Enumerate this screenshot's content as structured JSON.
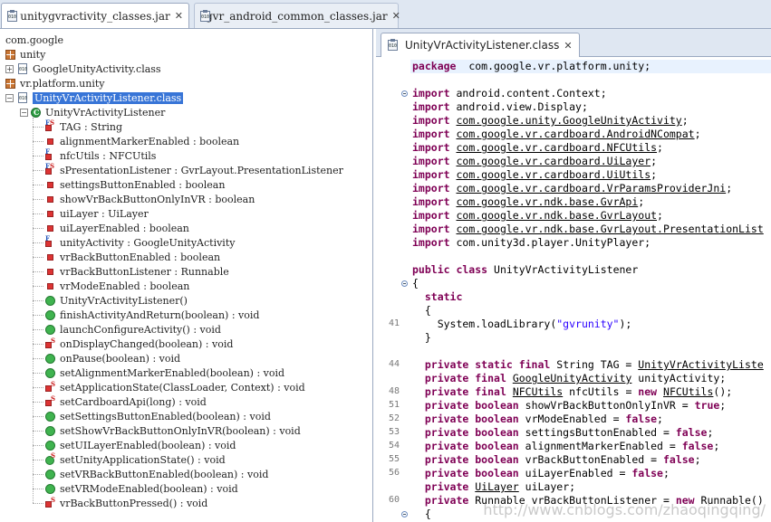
{
  "tabs": [
    {
      "label": "unitygvractivity_classes.jar",
      "active": true
    },
    {
      "label": "gvr_android_common_classes.jar",
      "active": false
    }
  ],
  "jar_icon_text": "010",
  "close_glyph": "✕",
  "tree": [
    {
      "text": "com.google",
      "indent": 0,
      "icon": "none"
    },
    {
      "text": "unity",
      "indent": 0,
      "icon": "package"
    },
    {
      "text": "GoogleUnityActivity.class",
      "indent": 1,
      "icon": "classfile",
      "expand": "+"
    },
    {
      "text": "vr.platform.unity",
      "indent": 0,
      "icon": "package"
    },
    {
      "text": "UnityVrActivityListener.class",
      "indent": 1,
      "icon": "classfile",
      "expand": "-",
      "selected": true
    },
    {
      "text": "UnityVrActivityListener",
      "indent": 2,
      "icon": "class",
      "expand": "-"
    },
    {
      "text": "TAG : String",
      "indent": 3,
      "icon": "field-static-final"
    },
    {
      "text": "alignmentMarkerEnabled : boolean",
      "indent": 3,
      "icon": "field"
    },
    {
      "text": "nfcUtils : NFCUtils",
      "indent": 3,
      "icon": "field-final"
    },
    {
      "text": "sPresentationListener : GvrLayout.PresentationListener",
      "indent": 3,
      "icon": "field-static-final"
    },
    {
      "text": "settingsButtonEnabled : boolean",
      "indent": 3,
      "icon": "field"
    },
    {
      "text": "showVrBackButtonOnlyInVR : boolean",
      "indent": 3,
      "icon": "field"
    },
    {
      "text": "uiLayer : UiLayer",
      "indent": 3,
      "icon": "field"
    },
    {
      "text": "uiLayerEnabled : boolean",
      "indent": 3,
      "icon": "field"
    },
    {
      "text": "unityActivity : GoogleUnityActivity",
      "indent": 3,
      "icon": "field-final"
    },
    {
      "text": "vrBackButtonEnabled : boolean",
      "indent": 3,
      "icon": "field"
    },
    {
      "text": "vrBackButtonListener : Runnable",
      "indent": 3,
      "icon": "field"
    },
    {
      "text": "vrModeEnabled : boolean",
      "indent": 3,
      "icon": "field"
    },
    {
      "text": "UnityVrActivityListener()",
      "indent": 3,
      "icon": "method"
    },
    {
      "text": "finishActivityAndReturn(boolean) : void",
      "indent": 3,
      "icon": "method"
    },
    {
      "text": "launchConfigureActivity() : void",
      "indent": 3,
      "icon": "method"
    },
    {
      "text": "onDisplayChanged(boolean) : void",
      "indent": 3,
      "icon": "field-static"
    },
    {
      "text": "onPause(boolean) : void",
      "indent": 3,
      "icon": "method"
    },
    {
      "text": "setAlignmentMarkerEnabled(boolean) : void",
      "indent": 3,
      "icon": "method"
    },
    {
      "text": "setApplicationState(ClassLoader, Context) : void",
      "indent": 3,
      "icon": "field-static"
    },
    {
      "text": "setCardboardApi(long) : void",
      "indent": 3,
      "icon": "field-static"
    },
    {
      "text": "setSettingsButtonEnabled(boolean) : void",
      "indent": 3,
      "icon": "method"
    },
    {
      "text": "setShowVrBackButtonOnlyInVR(boolean) : void",
      "indent": 3,
      "icon": "method"
    },
    {
      "text": "setUILayerEnabled(boolean) : void",
      "indent": 3,
      "icon": "method"
    },
    {
      "text": "setUnityApplicationState() : void",
      "indent": 3,
      "icon": "method-static"
    },
    {
      "text": "setVRBackButtonEnabled(boolean) : void",
      "indent": 3,
      "icon": "method"
    },
    {
      "text": "setVRModeEnabled(boolean) : void",
      "indent": 3,
      "icon": "method"
    },
    {
      "text": "vrBackButtonPressed() : void",
      "indent": 3,
      "icon": "field-static"
    }
  ],
  "editor_tab": "UnityVrActivityListener.class",
  "code_lines": [
    {
      "ln": "",
      "fold": false,
      "current": true,
      "parts": [
        [
          "kw",
          "package"
        ],
        [
          "",
          "  com.google.vr.platform.unity;"
        ]
      ]
    },
    {
      "ln": "",
      "fold": false,
      "parts": []
    },
    {
      "ln": "",
      "fold": true,
      "parts": [
        [
          "kw",
          "import"
        ],
        [
          "",
          " android.content.Context;"
        ]
      ]
    },
    {
      "ln": "",
      "fold": false,
      "parts": [
        [
          "kw",
          "import"
        ],
        [
          "",
          " android.view.Display;"
        ]
      ]
    },
    {
      "ln": "",
      "fold": false,
      "parts": [
        [
          "kw",
          "import"
        ],
        [
          "",
          " "
        ],
        [
          "u",
          "com.google.unity.GoogleUnityActivity"
        ],
        [
          "",
          ";"
        ]
      ]
    },
    {
      "ln": "",
      "fold": false,
      "parts": [
        [
          "kw",
          "import"
        ],
        [
          "",
          " "
        ],
        [
          "u",
          "com.google.vr.cardboard.AndroidNCompat"
        ],
        [
          "",
          ";"
        ]
      ]
    },
    {
      "ln": "",
      "fold": false,
      "parts": [
        [
          "kw",
          "import"
        ],
        [
          "",
          " "
        ],
        [
          "u",
          "com.google.vr.cardboard.NFCUtils"
        ],
        [
          "",
          ";"
        ]
      ]
    },
    {
      "ln": "",
      "fold": false,
      "parts": [
        [
          "kw",
          "import"
        ],
        [
          "",
          " "
        ],
        [
          "u",
          "com.google.vr.cardboard.UiLayer"
        ],
        [
          "",
          ";"
        ]
      ]
    },
    {
      "ln": "",
      "fold": false,
      "parts": [
        [
          "kw",
          "import"
        ],
        [
          "",
          " "
        ],
        [
          "u",
          "com.google.vr.cardboard.UiUtils"
        ],
        [
          "",
          ";"
        ]
      ]
    },
    {
      "ln": "",
      "fold": false,
      "parts": [
        [
          "kw",
          "import"
        ],
        [
          "",
          " "
        ],
        [
          "u",
          "com.google.vr.cardboard.VrParamsProviderJni"
        ],
        [
          "",
          ";"
        ]
      ]
    },
    {
      "ln": "",
      "fold": false,
      "parts": [
        [
          "kw",
          "import"
        ],
        [
          "",
          " "
        ],
        [
          "u",
          "com.google.vr.ndk.base.GvrApi"
        ],
        [
          "",
          ";"
        ]
      ]
    },
    {
      "ln": "",
      "fold": false,
      "parts": [
        [
          "kw",
          "import"
        ],
        [
          "",
          " "
        ],
        [
          "u",
          "com.google.vr.ndk.base.GvrLayout"
        ],
        [
          "",
          ";"
        ]
      ]
    },
    {
      "ln": "",
      "fold": false,
      "parts": [
        [
          "kw",
          "import"
        ],
        [
          "",
          " "
        ],
        [
          "u",
          "com.google.vr.ndk.base.GvrLayout.PresentationList"
        ]
      ]
    },
    {
      "ln": "",
      "fold": false,
      "parts": [
        [
          "kw",
          "import"
        ],
        [
          "",
          " com.unity3d.player.UnityPlayer;"
        ]
      ]
    },
    {
      "ln": "",
      "fold": false,
      "parts": []
    },
    {
      "ln": "",
      "fold": false,
      "parts": [
        [
          "kw",
          "public class"
        ],
        [
          "",
          " UnityVrActivityListener"
        ]
      ]
    },
    {
      "ln": "",
      "fold": true,
      "parts": [
        [
          "",
          "{"
        ]
      ]
    },
    {
      "ln": "",
      "fold": false,
      "parts": [
        [
          "",
          "  "
        ],
        [
          "kw",
          "static"
        ]
      ]
    },
    {
      "ln": "",
      "fold": false,
      "parts": [
        [
          "",
          "  {"
        ]
      ]
    },
    {
      "ln": "41",
      "fold": false,
      "parts": [
        [
          "",
          "    System.loadLibrary("
        ],
        [
          "str",
          "\"gvrunity\""
        ],
        [
          "",
          ");"
        ]
      ]
    },
    {
      "ln": "",
      "fold": false,
      "parts": [
        [
          "",
          "  }"
        ]
      ]
    },
    {
      "ln": "",
      "fold": false,
      "parts": []
    },
    {
      "ln": "44",
      "fold": false,
      "parts": [
        [
          "",
          "  "
        ],
        [
          "kw",
          "private static final"
        ],
        [
          "",
          " String TAG = "
        ],
        [
          "u",
          "UnityVrActivityListe"
        ]
      ]
    },
    {
      "ln": "",
      "fold": false,
      "parts": [
        [
          "",
          "  "
        ],
        [
          "kw",
          "private final"
        ],
        [
          "",
          " "
        ],
        [
          "u",
          "GoogleUnityActivity"
        ],
        [
          "",
          " unityActivity;"
        ]
      ]
    },
    {
      "ln": "48",
      "fold": false,
      "parts": [
        [
          "",
          "  "
        ],
        [
          "kw",
          "private final"
        ],
        [
          "",
          " "
        ],
        [
          "u",
          "NFCUtils"
        ],
        [
          "",
          " nfcUtils = "
        ],
        [
          "kw",
          "new"
        ],
        [
          "",
          " "
        ],
        [
          "u",
          "NFCUtils"
        ],
        [
          "",
          "();"
        ]
      ]
    },
    {
      "ln": "51",
      "fold": false,
      "parts": [
        [
          "",
          "  "
        ],
        [
          "kw",
          "private boolean"
        ],
        [
          "",
          " showVrBackButtonOnlyInVR = "
        ],
        [
          "kw",
          "true"
        ],
        [
          "",
          ";"
        ]
      ]
    },
    {
      "ln": "52",
      "fold": false,
      "parts": [
        [
          "",
          "  "
        ],
        [
          "kw",
          "private boolean"
        ],
        [
          "",
          " vrModeEnabled = "
        ],
        [
          "kw",
          "false"
        ],
        [
          "",
          ";"
        ]
      ]
    },
    {
      "ln": "53",
      "fold": false,
      "parts": [
        [
          "",
          "  "
        ],
        [
          "kw",
          "private boolean"
        ],
        [
          "",
          " settingsButtonEnabled = "
        ],
        [
          "kw",
          "false"
        ],
        [
          "",
          ";"
        ]
      ]
    },
    {
      "ln": "54",
      "fold": false,
      "parts": [
        [
          "",
          "  "
        ],
        [
          "kw",
          "private boolean"
        ],
        [
          "",
          " alignmentMarkerEnabled = "
        ],
        [
          "kw",
          "false"
        ],
        [
          "",
          ";"
        ]
      ]
    },
    {
      "ln": "55",
      "fold": false,
      "parts": [
        [
          "",
          "  "
        ],
        [
          "kw",
          "private boolean"
        ],
        [
          "",
          " vrBackButtonEnabled = "
        ],
        [
          "kw",
          "false"
        ],
        [
          "",
          ";"
        ]
      ]
    },
    {
      "ln": "56",
      "fold": false,
      "parts": [
        [
          "",
          "  "
        ],
        [
          "kw",
          "private boolean"
        ],
        [
          "",
          " uiLayerEnabled = "
        ],
        [
          "kw",
          "false"
        ],
        [
          "",
          ";"
        ]
      ]
    },
    {
      "ln": "",
      "fold": false,
      "parts": [
        [
          "",
          "  "
        ],
        [
          "kw",
          "private"
        ],
        [
          "",
          " "
        ],
        [
          "u",
          "UiLayer"
        ],
        [
          "",
          " uiLayer;"
        ]
      ]
    },
    {
      "ln": "60",
      "fold": false,
      "parts": [
        [
          "",
          "  "
        ],
        [
          "kw",
          "private"
        ],
        [
          "",
          " Runnable vrBackButtonListener = "
        ],
        [
          "kw",
          "new"
        ],
        [
          "",
          " Runnable()"
        ]
      ]
    },
    {
      "ln": "",
      "fold": true,
      "parts": [
        [
          "",
          "  {"
        ]
      ]
    }
  ],
  "watermark": "http://www.cnblogs.com/zhaoqingqing/"
}
